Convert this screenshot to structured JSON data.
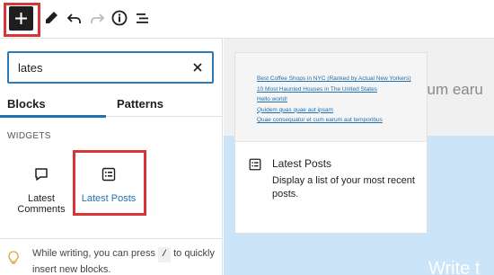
{
  "toolbar": {
    "buttons": [
      {
        "name": "add-block",
        "icon": "plus-icon"
      },
      {
        "name": "tools",
        "icon": "pencil-icon"
      },
      {
        "name": "undo",
        "icon": "undo-icon"
      },
      {
        "name": "redo",
        "icon": "redo-icon"
      },
      {
        "name": "details",
        "icon": "info-icon"
      },
      {
        "name": "list-view",
        "icon": "list-view-icon"
      }
    ]
  },
  "inserter": {
    "search_value": "lates",
    "tabs": [
      {
        "label": "Blocks",
        "active": true
      },
      {
        "label": "Patterns",
        "active": false
      }
    ],
    "section_title": "WIDGETS",
    "blocks": [
      {
        "label": "Latest Comments",
        "icon": "comment-icon"
      },
      {
        "label": "Latest Posts",
        "icon": "post-list-icon",
        "selected": true
      }
    ],
    "tip": {
      "before": "While writing, you can press",
      "key": "/",
      "after": "to quickly insert new blocks."
    }
  },
  "preview": {
    "links": [
      "Best Coffee Shops in NYC (Ranked by Actual New Yorkers)",
      "10 Most Haunted Houses in The United States",
      "Hello world!",
      "Quidem quas quae aut ipsam",
      "Quae consequatur et cum earum aut temporibus"
    ],
    "title": "Latest Posts",
    "description": "Display a list of your most recent posts."
  },
  "canvas": {
    "title_fragment": "cum earu",
    "placeholder_fragment": "Write t"
  },
  "colors": {
    "accent": "#2271b1",
    "highlight": "#d63638",
    "dark": "#1e1e1e",
    "canvas_blue": "#cbe4f7"
  }
}
